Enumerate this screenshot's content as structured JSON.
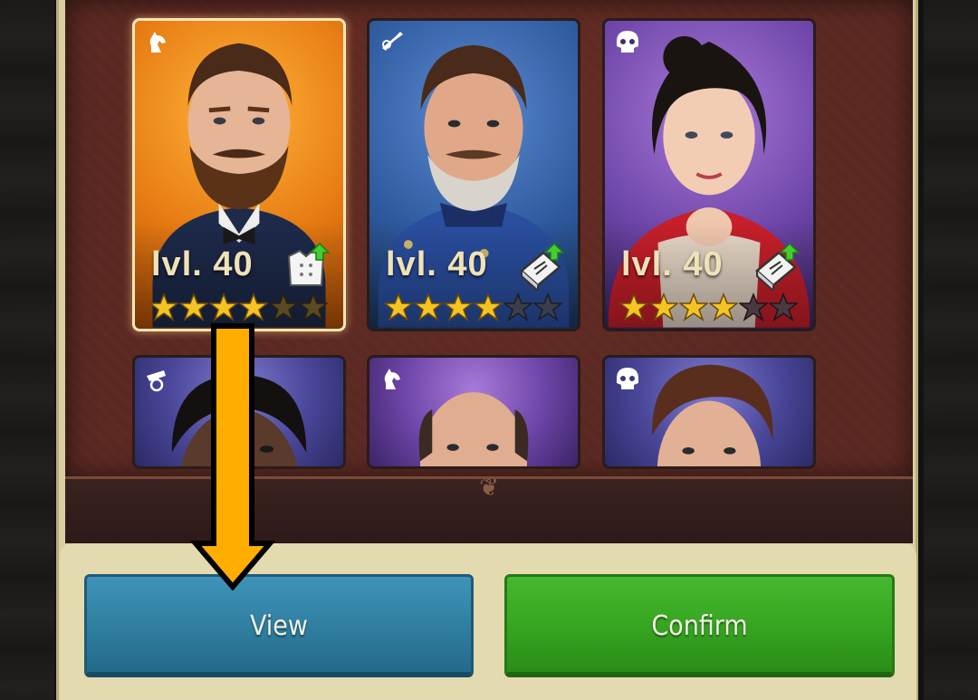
{
  "cards": [
    {
      "level": "lvl. 40",
      "stars_filled": 4,
      "stars_total": 6,
      "class_icon": "horse-knight-icon",
      "equip_icon": "chef-coat-upgrade-icon",
      "theme": "orange",
      "selected": true
    },
    {
      "level": "lvl. 40",
      "stars_filled": 4,
      "stars_total": 6,
      "class_icon": "bugle-icon",
      "equip_icon": "book-upgrade-icon",
      "theme": "blue",
      "selected": false
    },
    {
      "level": "lvl. 40",
      "stars_filled": 4,
      "stars_total": 6,
      "class_icon": "skull-icon",
      "equip_icon": "book-upgrade-icon",
      "theme": "purple",
      "selected": false
    },
    {
      "class_icon": "cannon-icon",
      "theme": "bluepurple"
    },
    {
      "class_icon": "horse-knight-icon",
      "theme": "purple"
    },
    {
      "class_icon": "skull-icon",
      "theme": "bluepurple"
    }
  ],
  "buttons": {
    "view_label": "View",
    "confirm_label": "Confirm"
  },
  "annotation": {
    "type": "arrow-down",
    "color": "#ffae00",
    "target": "view-button"
  },
  "colors": {
    "view_button": "#2f7ea0",
    "confirm_button": "#36a420",
    "panel_bg": "#5c2a23",
    "frame": "#d9cfa0"
  }
}
